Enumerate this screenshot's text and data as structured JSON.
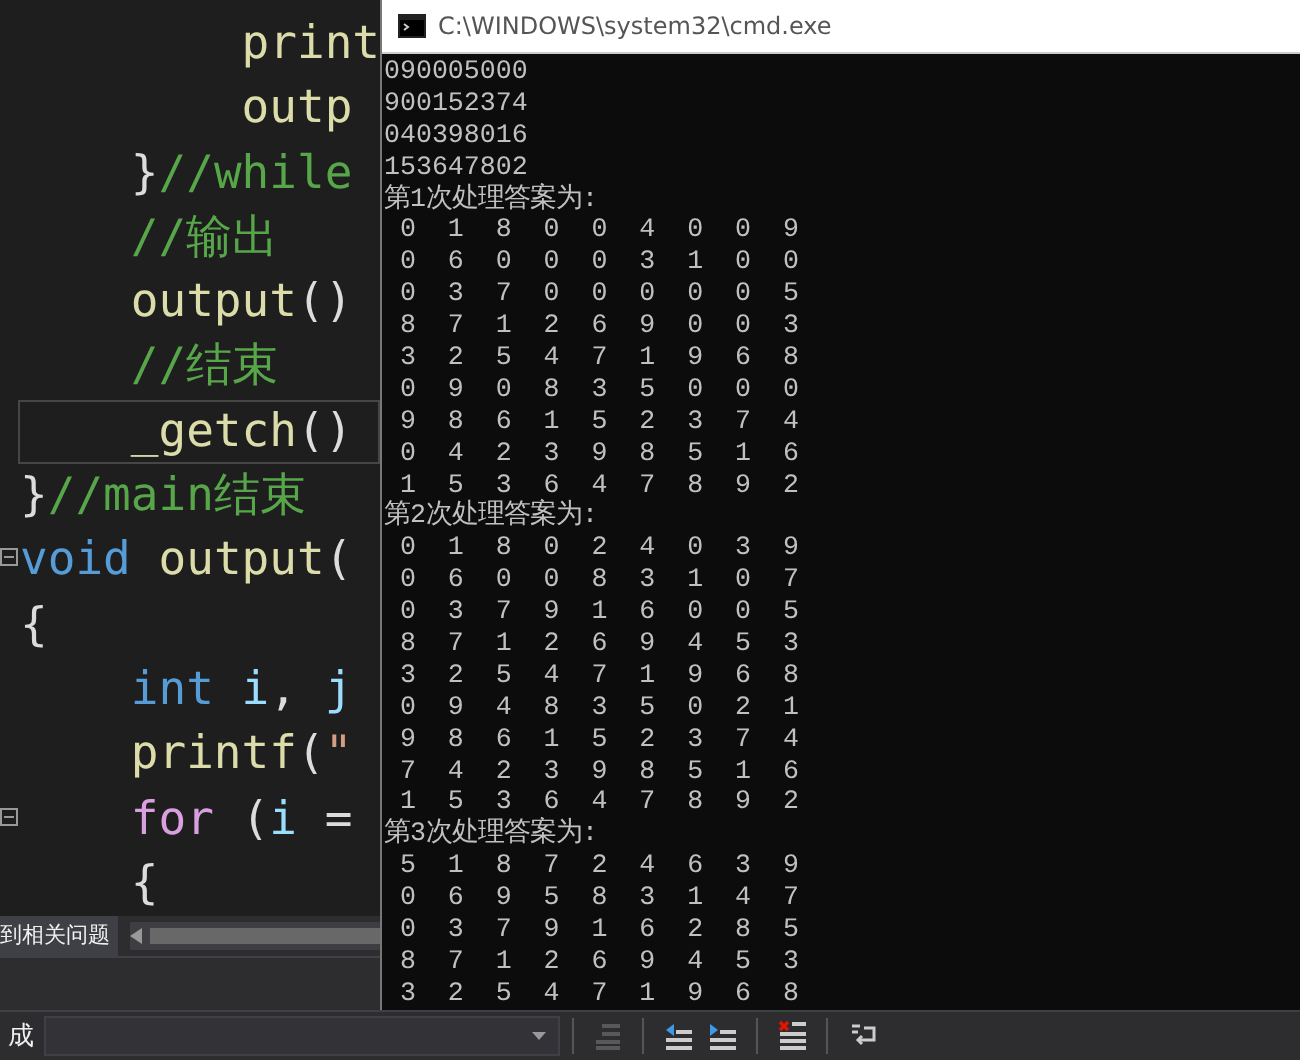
{
  "editor": {
    "lines": [
      {
        "current": false,
        "foldable": false,
        "tokens": [
          {
            "kind": "func",
            "text": "        print"
          }
        ]
      },
      {
        "current": false,
        "foldable": false,
        "tokens": [
          {
            "kind": "func",
            "text": "        outp"
          }
        ]
      },
      {
        "current": false,
        "foldable": false,
        "tokens": [
          {
            "kind": "plain",
            "text": "    }"
          },
          {
            "kind": "comment",
            "text": "//while"
          }
        ]
      },
      {
        "current": false,
        "foldable": false,
        "tokens": [
          {
            "kind": "comment",
            "text": "    //输出"
          }
        ]
      },
      {
        "current": false,
        "foldable": false,
        "tokens": [
          {
            "kind": "func",
            "text": "    output"
          },
          {
            "kind": "plain",
            "text": "()"
          }
        ]
      },
      {
        "current": false,
        "foldable": false,
        "tokens": [
          {
            "kind": "comment",
            "text": "    //结束"
          }
        ]
      },
      {
        "current": true,
        "foldable": false,
        "tokens": [
          {
            "kind": "func",
            "text": "    _getch"
          },
          {
            "kind": "plain",
            "text": "()"
          }
        ]
      },
      {
        "current": false,
        "foldable": false,
        "tokens": [
          {
            "kind": "plain",
            "text": "}"
          },
          {
            "kind": "comment",
            "text": "//main结束"
          }
        ]
      },
      {
        "current": false,
        "foldable": true,
        "tokens": [
          {
            "kind": "keyword",
            "text": "void "
          },
          {
            "kind": "func",
            "text": "output"
          },
          {
            "kind": "plain",
            "text": "("
          }
        ]
      },
      {
        "current": false,
        "foldable": false,
        "tokens": [
          {
            "kind": "plain",
            "text": "{"
          }
        ]
      },
      {
        "current": false,
        "foldable": false,
        "tokens": [
          {
            "kind": "keyword",
            "text": "    int "
          },
          {
            "kind": "variable",
            "text": "i"
          },
          {
            "kind": "plain",
            "text": ", "
          },
          {
            "kind": "variable",
            "text": "j"
          }
        ]
      },
      {
        "current": false,
        "foldable": false,
        "tokens": [
          {
            "kind": "func",
            "text": "    printf"
          },
          {
            "kind": "plain",
            "text": "("
          },
          {
            "kind": "string",
            "text": "\""
          }
        ]
      },
      {
        "current": false,
        "foldable": true,
        "tokens": [
          {
            "kind": "control",
            "text": "    for"
          },
          {
            "kind": "plain",
            "text": " ("
          },
          {
            "kind": "variable",
            "text": "i"
          },
          {
            "kind": "plain",
            "text": " ="
          }
        ]
      },
      {
        "current": false,
        "foldable": false,
        "tokens": [
          {
            "kind": "plain",
            "text": "    {"
          }
        ]
      }
    ]
  },
  "problems_strip": {
    "label": "到相关问题"
  },
  "console": {
    "title": "C:\\WINDOWS\\system32\\cmd.exe",
    "lines": [
      "090005000",
      "900152374",
      "040398016",
      "153647802",
      "第1次处理答案为:",
      " 0  1  8  0  0  4  0  0  9",
      " 0  6  0  0  0  3  1  0  0",
      " 0  3  7  0  0  0  0  0  5",
      " 8  7  1  2  6  9  0  0  3",
      " 3  2  5  4  7  1  9  6  8",
      " 0  9  0  8  3  5  0  0  0",
      " 9  8  6  1  5  2  3  7  4",
      " 0  4  2  3  9  8  5  1  6",
      " 1  5  3  6  4  7  8  9  2",
      "第2次处理答案为:",
      " 0  1  8  0  2  4  0  3  9",
      " 0  6  0  0  8  3  1  0  7",
      " 0  3  7  9  1  6  0  0  5",
      " 8  7  1  2  6  9  4  5  3",
      " 3  2  5  4  7  1  9  6  8",
      " 0  9  4  8  3  5  0  2  1",
      " 9  8  6  1  5  2  3  7  4",
      " 7  4  2  3  9  8  5  1  6",
      " 1  5  3  6  4  7  8  9  2",
      "第3次处理答案为:",
      " 5  1  8  7  2  4  6  3  9",
      " 0  6  9  5  8  3  1  4  7",
      " 0  3  7  9  1  6  2  8  5",
      " 8  7  1  2  6  9  4  5  3",
      " 3  2  5  4  7  1  9  6  8"
    ]
  },
  "status_bar": {
    "label": "成",
    "toolbar": [
      {
        "kind": "list",
        "disabled": true
      },
      {
        "kind": "outdent",
        "disabled": false
      },
      {
        "kind": "indent",
        "disabled": false
      },
      {
        "kind": "remove",
        "disabled": false
      },
      {
        "kind": "wrap",
        "disabled": false
      }
    ]
  }
}
